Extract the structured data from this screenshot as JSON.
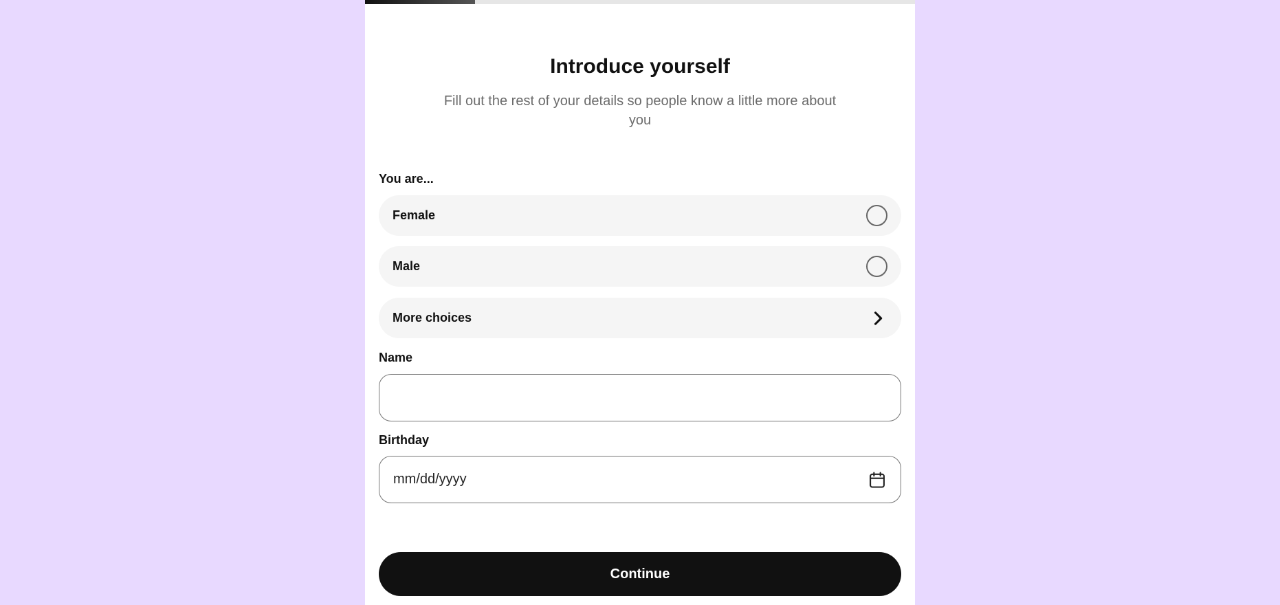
{
  "progress": {
    "percent": 20,
    "fill_color": "#111111",
    "track_color": "#e6e6e6"
  },
  "header": {
    "title": "Introduce yourself",
    "subtitle": "Fill out the rest of your details so people know a little more about you"
  },
  "gender": {
    "label": "You are...",
    "options": [
      {
        "label": "Female",
        "icon": "radio-unchecked",
        "selected": false
      },
      {
        "label": "Male",
        "icon": "radio-unchecked",
        "selected": false
      },
      {
        "label": "More choices",
        "icon": "chevron-right"
      }
    ]
  },
  "name": {
    "label": "Name",
    "value": "",
    "placeholder": ""
  },
  "birthday": {
    "label": "Birthday",
    "placeholder": "mm/dd/yyyy",
    "icon": "calendar-icon"
  },
  "continue_label": "Continue",
  "colors": {
    "background": "#e8d9ff",
    "panel": "#ffffff",
    "button": "#111111",
    "option_bg": "#f5f5f5"
  }
}
